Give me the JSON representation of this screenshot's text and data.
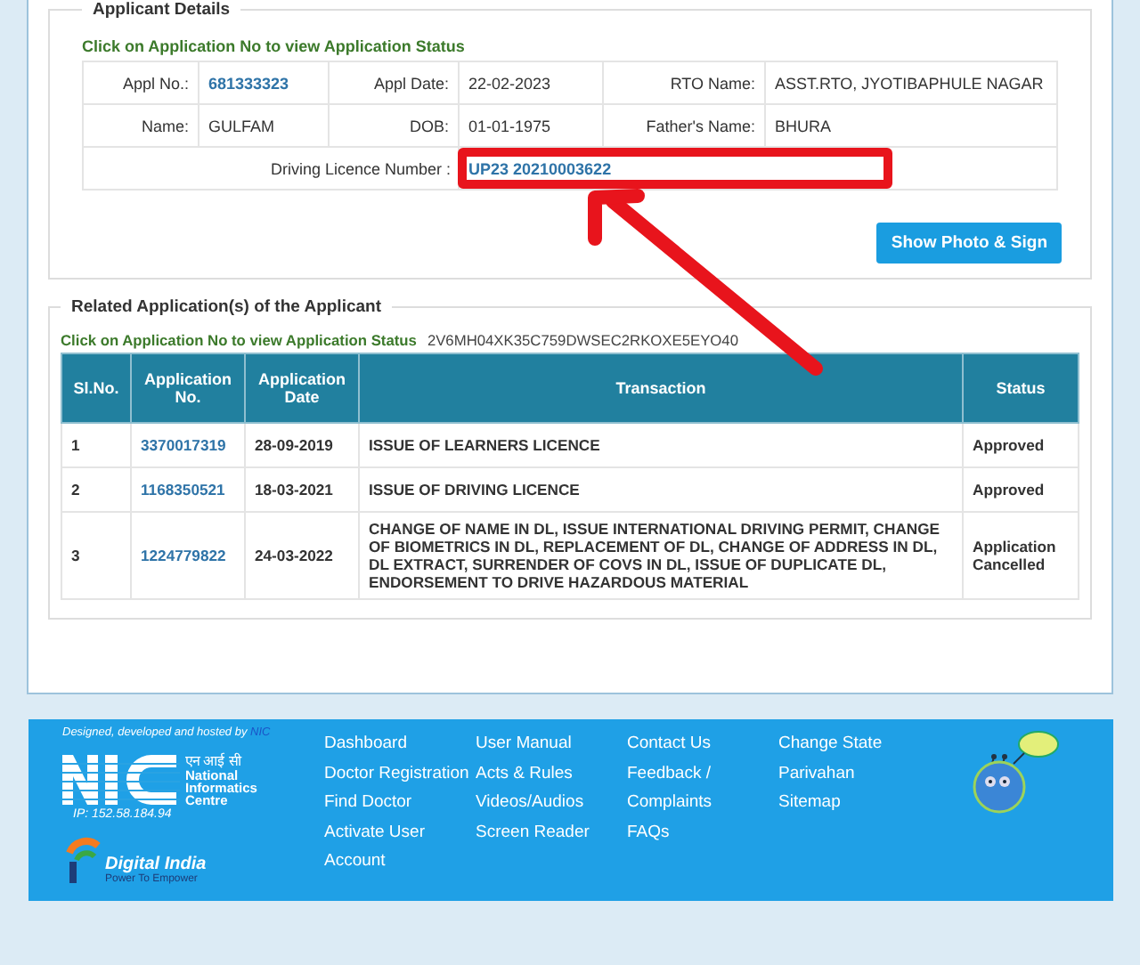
{
  "applicant": {
    "legend": "Applicant Details",
    "hint": "Click on Application No to view Application Status",
    "rows": [
      [
        {
          "label": "Appl No.:",
          "value": "681333323",
          "kind": "link"
        },
        {
          "label": "Appl Date:",
          "value": "22-02-2023",
          "kind": "text"
        },
        {
          "label": "RTO Name:",
          "value": "ASST.RTO, JYOTIBAPHULE NAGAR",
          "kind": "text"
        }
      ],
      [
        {
          "label": "Name:",
          "value": "GULFAM",
          "kind": "text"
        },
        {
          "label": "DOB:",
          "value": "01-01-1975",
          "kind": "text"
        },
        {
          "label": "Father's  Name:",
          "value": "BHURA",
          "kind": "text"
        }
      ]
    ],
    "licence": {
      "label": "Driving Licence Number :",
      "value": "UP23 20210003622"
    },
    "button": "Show Photo & Sign"
  },
  "related": {
    "legend": "Related Application(s) of the Applicant",
    "hint": "Click on Application No to view Application Status",
    "code": "2V6MH04XK35C759DWSEC2RKOXE5EYO40",
    "columns": [
      "Sl.No.",
      "Application No.",
      "Application Date",
      "Transaction",
      "Status"
    ],
    "rows": [
      {
        "sl": "1",
        "app_no": "3370017319",
        "date": "28-09-2019",
        "transaction": "ISSUE OF LEARNERS LICENCE",
        "status": "Approved"
      },
      {
        "sl": "2",
        "app_no": "1168350521",
        "date": "18-03-2021",
        "transaction": "ISSUE OF DRIVING LICENCE",
        "status": "Approved"
      },
      {
        "sl": "3",
        "app_no": "1224779822",
        "date": "24-03-2022",
        "transaction": "CHANGE OF NAME IN DL, ISSUE INTERNATIONAL DRIVING PERMIT, CHANGE OF BIOMETRICS IN DL, REPLACEMENT OF DL, CHANGE OF ADDRESS IN DL, DL EXTRACT, SURRENDER OF COVS IN DL, ISSUE OF DUPLICATE DL, ENDORSEMENT TO DRIVE HAZARDOUS MATERIAL",
        "status": "Application Cancelled"
      }
    ]
  },
  "footer": {
    "credit": "Designed, developed and hosted by",
    "credit_link": "NIC",
    "nic_hindi": "एन आई सी",
    "nic_name": [
      "National",
      "Informatics",
      "Centre"
    ],
    "ip": "IP: 152.58.184.94",
    "digital_india": "Digital India",
    "digital_india_tagline": "Power To Empower",
    "link_columns": [
      [
        "Dashboard",
        "Doctor Registration",
        "Find Doctor",
        "Activate User",
        "Account"
      ],
      [
        "User Manual",
        "Acts & Rules",
        "Videos/Audios",
        "Screen Reader"
      ],
      [
        "Contact Us",
        "Feedback /",
        "Complaints",
        "FAQs"
      ],
      [
        "Change State",
        "Parivahan",
        "Sitemap"
      ]
    ]
  }
}
